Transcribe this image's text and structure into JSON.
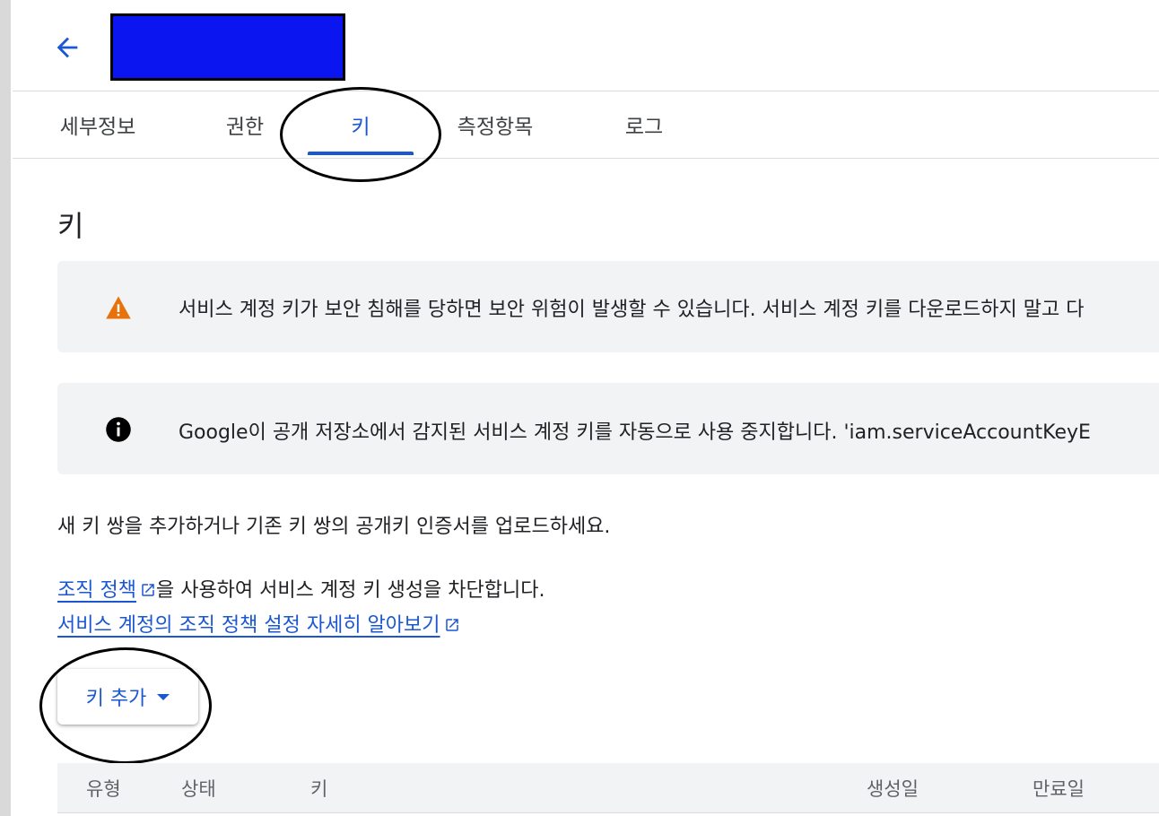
{
  "header": {
    "back_icon": "arrow-back-icon",
    "title_redacted_color": "#0a15f0"
  },
  "tabs": [
    {
      "label": "세부정보",
      "active": false
    },
    {
      "label": "권한",
      "active": false
    },
    {
      "label": "키",
      "active": true
    },
    {
      "label": "측정항목",
      "active": false
    },
    {
      "label": "로그",
      "active": false
    }
  ],
  "section": {
    "title": "키"
  },
  "banners": {
    "warning": {
      "icon": "warning-icon",
      "text": "서비스 계정 키가 보안 침해를 당하면 보안 위험이 발생할 수 있습니다. 서비스 계정 키를 다운로드하지 말고 다"
    },
    "info": {
      "icon": "info-icon",
      "text": "Google이 공개 저장소에서 감지된 서비스 계정 키를 자동으로 사용 중지합니다. 'iam.serviceAccountKeyE"
    }
  },
  "description": "새 키 쌍을 추가하거나 기존 키 쌍의 공개키 인증서를 업로드하세요.",
  "policy": {
    "link_text": "조직 정책",
    "suffix": "을 사용하여 서비스 계정 키 생성을 차단합니다.",
    "learn_more": "서비스 계정의 조직 정책 설정 자세히 알아보기"
  },
  "add_key_button": {
    "label": "키 추가"
  },
  "table": {
    "columns": [
      "유형",
      "상태",
      "키",
      "생성일",
      "만료일"
    ]
  },
  "colors": {
    "accent": "#1a57d0",
    "warning": "#e8710a",
    "banner_bg": "#f1f3f4"
  }
}
